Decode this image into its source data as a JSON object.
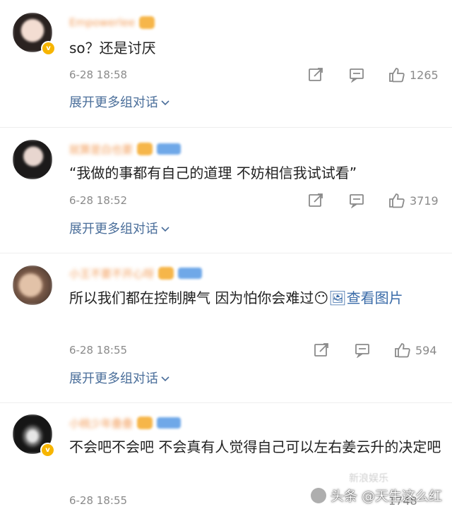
{
  "comments": [
    {
      "username": "Empowerlee",
      "text": "so？还是讨厌",
      "time": "6-28 18:58",
      "likes": "1265",
      "expand_label": "展开更多组对话"
    },
    {
      "username": "就算是白也要",
      "text": "“我做的事都有自己的道理 不妨相信我试试看”",
      "time": "6-28 18:52",
      "likes": "3719",
      "expand_label": "展开更多组对话"
    },
    {
      "username": "小王不要不开心呀",
      "text_main": "所以我们都在控制脾气 因为怕你会难过😶",
      "text_link": "🖼查看图片",
      "time": "6-28 18:55",
      "likes": "594",
      "expand_label": "展开更多组对话"
    },
    {
      "username": "小桃少年叠叠",
      "text": "不会吧不会吧  不会真有人觉得自己可以左右姜云升的决定吧",
      "time": "6-28 18:55",
      "likes": "1748"
    }
  ],
  "watermark": {
    "text": "头条 @天生这么红",
    "faint_text": "新浪娱乐"
  },
  "colors": {
    "name": "#f08a3a",
    "link": "#4a6e9a",
    "meta": "#8a8a8a",
    "badge": "#f7b500"
  },
  "icons": [
    "share-icon",
    "comment-icon",
    "like-icon",
    "chevron-down-icon",
    "verified-badge-icon"
  ]
}
